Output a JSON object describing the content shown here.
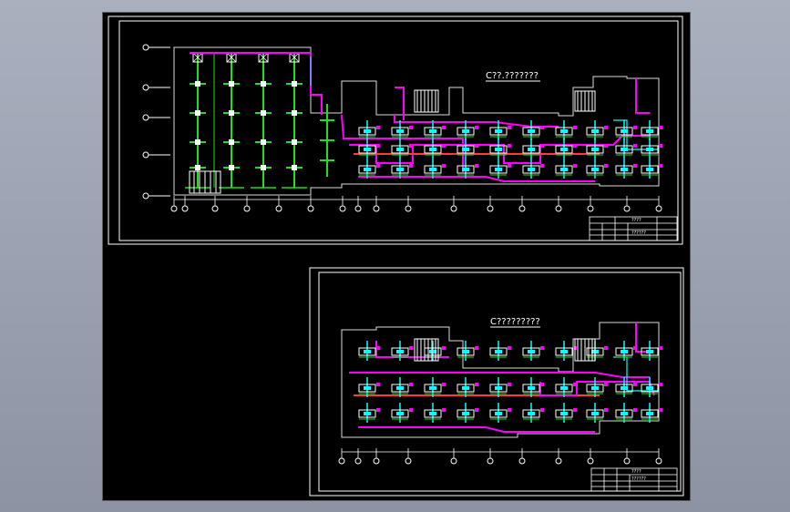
{
  "sheets": [
    {
      "title": "C??.???????",
      "title_block": {
        "drawing_name": "??????",
        "header": "????"
      }
    },
    {
      "title": "C?????????",
      "title_block": {
        "drawing_name": "??????",
        "header": "????"
      }
    }
  ],
  "colors": {
    "background": "#000000",
    "frame": "#ffffff",
    "pipe_magenta": "#ff00ff",
    "pipe_cyan": "#00ffff",
    "pipe_red": "#ff3b3b",
    "pipe_green": "#22dd22",
    "window_bg": "#9aa1b0"
  }
}
